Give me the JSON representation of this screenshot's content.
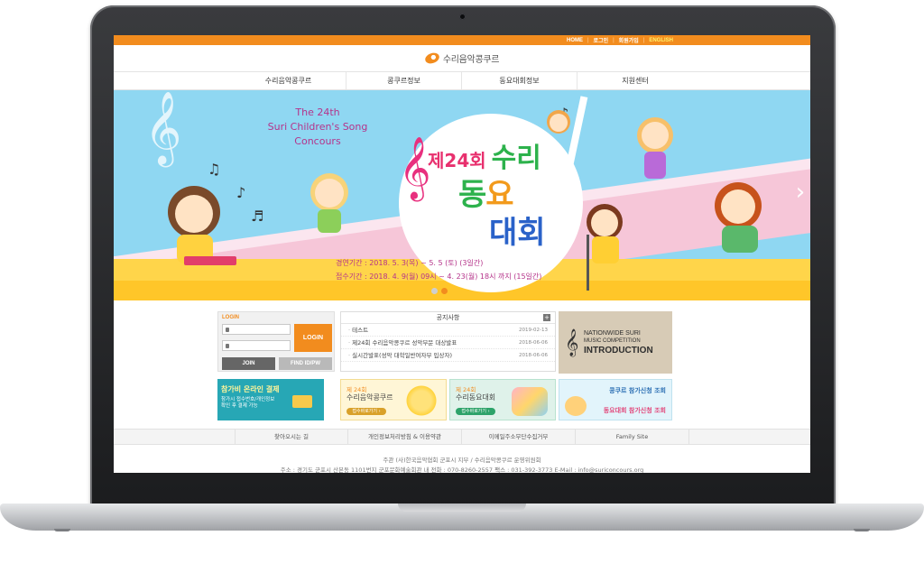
{
  "topbar": {
    "home": "HOME",
    "login": "로그인",
    "signup": "회원가입",
    "english": "ENGLISH",
    "separator": "|"
  },
  "site": {
    "logo_text": "수리음악콩쿠르"
  },
  "gnb": [
    {
      "label": "수리음악콩쿠르"
    },
    {
      "label": "콩쿠르정보"
    },
    {
      "label": "동요대회정보"
    },
    {
      "label": "지원센터"
    }
  ],
  "hero": {
    "english_title_lines": [
      "The 24th",
      "Suri Children's Song",
      "Concours"
    ],
    "title_prefix": "제24회",
    "title_suri": "수리",
    "title_dong": "동",
    "title_yo": "요",
    "title_daehoe": "대회",
    "dates": [
      "경연기간 : 2018. 5. 3(목) ~ 5. 5 (토) (3일간)",
      "접수기간 : 2018. 4. 9(월) 09시 ~ 4. 23(월) 18시 까지 (15일간)"
    ],
    "slide_active": 2,
    "slide_count": 2,
    "next_arrow": "›"
  },
  "login": {
    "title": "LOGIN",
    "button": "LOGIN",
    "join": "JOIN",
    "find": "FIND ID/PW"
  },
  "notice": {
    "title": "공지사항",
    "more": "+",
    "items": [
      {
        "title": "테스트",
        "date": "2019-02-13"
      },
      {
        "title": "제24회 수리음악콩쿠르 성악부문 대상발표",
        "date": "2018-06-06"
      },
      {
        "title": "실시간발표(성악 대학일반여자부 입상자)",
        "date": "2018-06-06"
      }
    ]
  },
  "intro": {
    "line1": "NATIONWIDE SURI",
    "line2": "MUSIC COMPETITION",
    "line3": "INTRODUCTION"
  },
  "banners": {
    "payment": {
      "title": "참가비 온라인 결제",
      "desc1": "참가시 접수번호/개인정보",
      "desc2": "확인 후 결제 가능"
    },
    "music": {
      "edition": "제 24회",
      "name": "수리음악콩쿠르",
      "go": "접수바로가기 ›"
    },
    "song": {
      "edition": "제 24회",
      "name": "수리동요대회",
      "go": "접수바로가기 ›"
    },
    "inquiry": {
      "line1": "콩쿠르 참가신청 조회",
      "line2": "동요대회 참가신청 조회"
    }
  },
  "footer": {
    "links": [
      {
        "label": "찾아오시는 길"
      },
      {
        "label": "개인정보처리방침 & 이용약관"
      },
      {
        "label": "이메일주소무단수집거부"
      },
      {
        "label": "Family Site"
      }
    ],
    "line1": "주관 (사)한국음악협회 군포시 지부 / 수리음악콩쿠르 운영위원회",
    "line2": "주소 : 경기도 군포시 산본동 1101번지 군포문화예술회관 내 전화 : 070-8260-2557 팩스 : 031-392-3773 E-Mail : info@suriconcours.org"
  },
  "colors": {
    "accent": "#f28c1e",
    "hero_sky": "#8fd7f2",
    "hero_pink": "#e8306e"
  }
}
